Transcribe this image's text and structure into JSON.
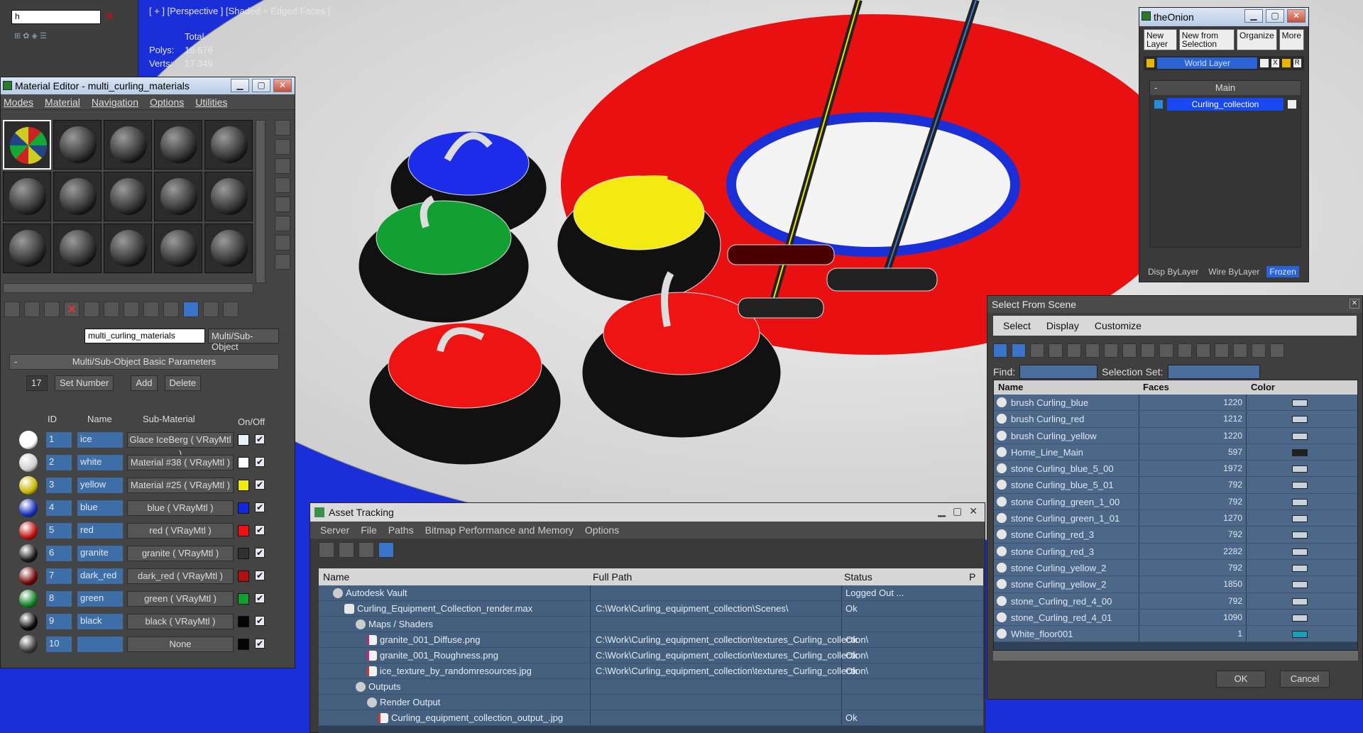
{
  "viewport": {
    "label": "[ + ] [Perspective ] [Shaded + Edged Faces ]",
    "stats": {
      "header": "Total",
      "polys_label": "Polys:",
      "polys": "16 676",
      "verts_label": "Verts:",
      "verts": "17 349"
    }
  },
  "scene_explorer": {
    "search_value": "h"
  },
  "material_editor": {
    "title": "Material Editor - multi_curling_materials",
    "menu": [
      "Modes",
      "Material",
      "Navigation",
      "Options",
      "Utilities"
    ],
    "material_name": "multi_curling_materials",
    "material_type": "Multi/Sub-Object",
    "rollout_title": "Multi/Sub-Object Basic Parameters",
    "set_number_value": "17",
    "set_number_label": "Set Number",
    "add_label": "Add",
    "delete_label": "Delete",
    "columns": {
      "id": "ID",
      "name": "Name",
      "sub": "Sub-Material",
      "onoff": "On/Off"
    },
    "rows": [
      {
        "id": "1",
        "name": "ice",
        "sub": "Glace IceBerg ( VRayMtl )",
        "color": "#e8f0f8",
        "swatch": "#ffffff"
      },
      {
        "id": "2",
        "name": "white",
        "sub": "Material #38 ( VRayMtl )",
        "color": "#ffffff",
        "swatch": "#cfcfcf"
      },
      {
        "id": "3",
        "name": "yellow",
        "sub": "Material #25 ( VRayMtl )",
        "color": "#f0ea10",
        "swatch": "#c8b800"
      },
      {
        "id": "4",
        "name": "blue",
        "sub": "blue ( VRayMtl )",
        "color": "#1028e0",
        "swatch": "#1830b8"
      },
      {
        "id": "5",
        "name": "red",
        "sub": "red ( VRayMtl )",
        "color": "#f01010",
        "swatch": "#c01010"
      },
      {
        "id": "6",
        "name": "granite",
        "sub": "granite ( VRayMtl )",
        "color": "#303030",
        "swatch": "#1a1a1a"
      },
      {
        "id": "7",
        "name": "dark_red",
        "sub": "dark_red ( VRayMtl )",
        "color": "#b01010",
        "swatch": "#700808"
      },
      {
        "id": "8",
        "name": "green",
        "sub": "green ( VRayMtl )",
        "color": "#10a030",
        "swatch": "#108028"
      },
      {
        "id": "9",
        "name": "black",
        "sub": "black ( VRayMtl )",
        "color": "#050505",
        "swatch": "#0a0a0a"
      },
      {
        "id": "10",
        "name": "",
        "sub": "None",
        "color": "#050505",
        "swatch": "#3a3a3a"
      }
    ]
  },
  "onion": {
    "title": "theOnion",
    "buttons": [
      "New Layer",
      "New from Selection",
      "Organize",
      "More"
    ],
    "world_layer": "World Layer",
    "x": "X",
    "r": "R",
    "main_title": "Main",
    "main_item": "Curling_collection",
    "bottom": [
      "Disp ByLayer",
      "Wire ByLayer",
      "Frozen"
    ]
  },
  "select_from_scene": {
    "title": "Select From Scene",
    "tabs": [
      "Select",
      "Display",
      "Customize"
    ],
    "find_label": "Find:",
    "selection_set_label": "Selection Set:",
    "columns": {
      "name": "Name",
      "faces": "Faces",
      "color": "Color"
    },
    "rows": [
      {
        "name": "brush Curling_blue",
        "faces": "1220",
        "color": "#c8d2dc"
      },
      {
        "name": "brush Curling_red",
        "faces": "1212",
        "color": "#c8d2dc"
      },
      {
        "name": "brush Curling_yellow",
        "faces": "1220",
        "color": "#c8d2dc"
      },
      {
        "name": "Home_Line_Main",
        "faces": "597",
        "color": "#202020"
      },
      {
        "name": "stone Curling_blue_5_00",
        "faces": "1972",
        "color": "#c8d2dc"
      },
      {
        "name": "stone Curling_blue_5_01",
        "faces": "792",
        "color": "#c8d2dc"
      },
      {
        "name": "stone Curling_green_1_00",
        "faces": "792",
        "color": "#c8d2dc"
      },
      {
        "name": "stone Curling_green_1_01",
        "faces": "1270",
        "color": "#c8d2dc"
      },
      {
        "name": "stone Curling_red_3",
        "faces": "792",
        "color": "#c8d2dc"
      },
      {
        "name": "stone Curling_red_3",
        "faces": "2282",
        "color": "#c8d2dc"
      },
      {
        "name": "stone Curling_yellow_2",
        "faces": "792",
        "color": "#c8d2dc"
      },
      {
        "name": "stone Curling_yellow_2",
        "faces": "1850",
        "color": "#c8d2dc"
      },
      {
        "name": "stone_Curling_red_4_00",
        "faces": "792",
        "color": "#c8d2dc"
      },
      {
        "name": "stone_Curling_red_4_01",
        "faces": "1090",
        "color": "#c8d2dc"
      },
      {
        "name": "White_floor001",
        "faces": "1",
        "color": "#1aa0b8"
      }
    ],
    "ok_label": "OK",
    "cancel_label": "Cancel"
  },
  "asset_tracking": {
    "title": "Asset Tracking",
    "menu": [
      "Server",
      "File",
      "Paths",
      "Bitmap Performance and Memory",
      "Options"
    ],
    "columns": {
      "name": "Name",
      "path": "Full Path",
      "status": "Status",
      "extra": "P"
    },
    "rows": [
      {
        "indent": 0,
        "icon": "v",
        "name": "Autodesk Vault",
        "path": "",
        "status": "Logged Out ..."
      },
      {
        "indent": 1,
        "icon": "m",
        "name": "Curling_Equipment_Collection_render.max",
        "path": "C:\\Work\\Curling_equipment_collection\\Scenes\\",
        "status": "Ok"
      },
      {
        "indent": 2,
        "icon": "v",
        "name": "Maps / Shaders",
        "path": "",
        "status": ""
      },
      {
        "indent": 3,
        "icon": "png",
        "name": "granite_001_Diffuse.png",
        "path": "C:\\Work\\Curling_equipment_collection\\textures_Curling_collection\\",
        "status": "Ok"
      },
      {
        "indent": 3,
        "icon": "png",
        "name": "granite_001_Roughness.png",
        "path": "C:\\Work\\Curling_equipment_collection\\textures_Curling_collection\\",
        "status": "Ok"
      },
      {
        "indent": 3,
        "icon": "jpg",
        "name": "ice_texture_by_randomresources.jpg",
        "path": "C:\\Work\\Curling_equipment_collection\\textures_Curling_collection\\",
        "status": "Ok"
      },
      {
        "indent": 2,
        "icon": "v",
        "name": "Outputs",
        "path": "",
        "status": ""
      },
      {
        "indent": 3,
        "icon": "v",
        "name": "Render Output",
        "path": "",
        "status": ""
      },
      {
        "indent": 4,
        "icon": "jpg",
        "name": "Curling_equipment_collection_output_.jpg",
        "path": "",
        "status": "Ok"
      }
    ]
  }
}
